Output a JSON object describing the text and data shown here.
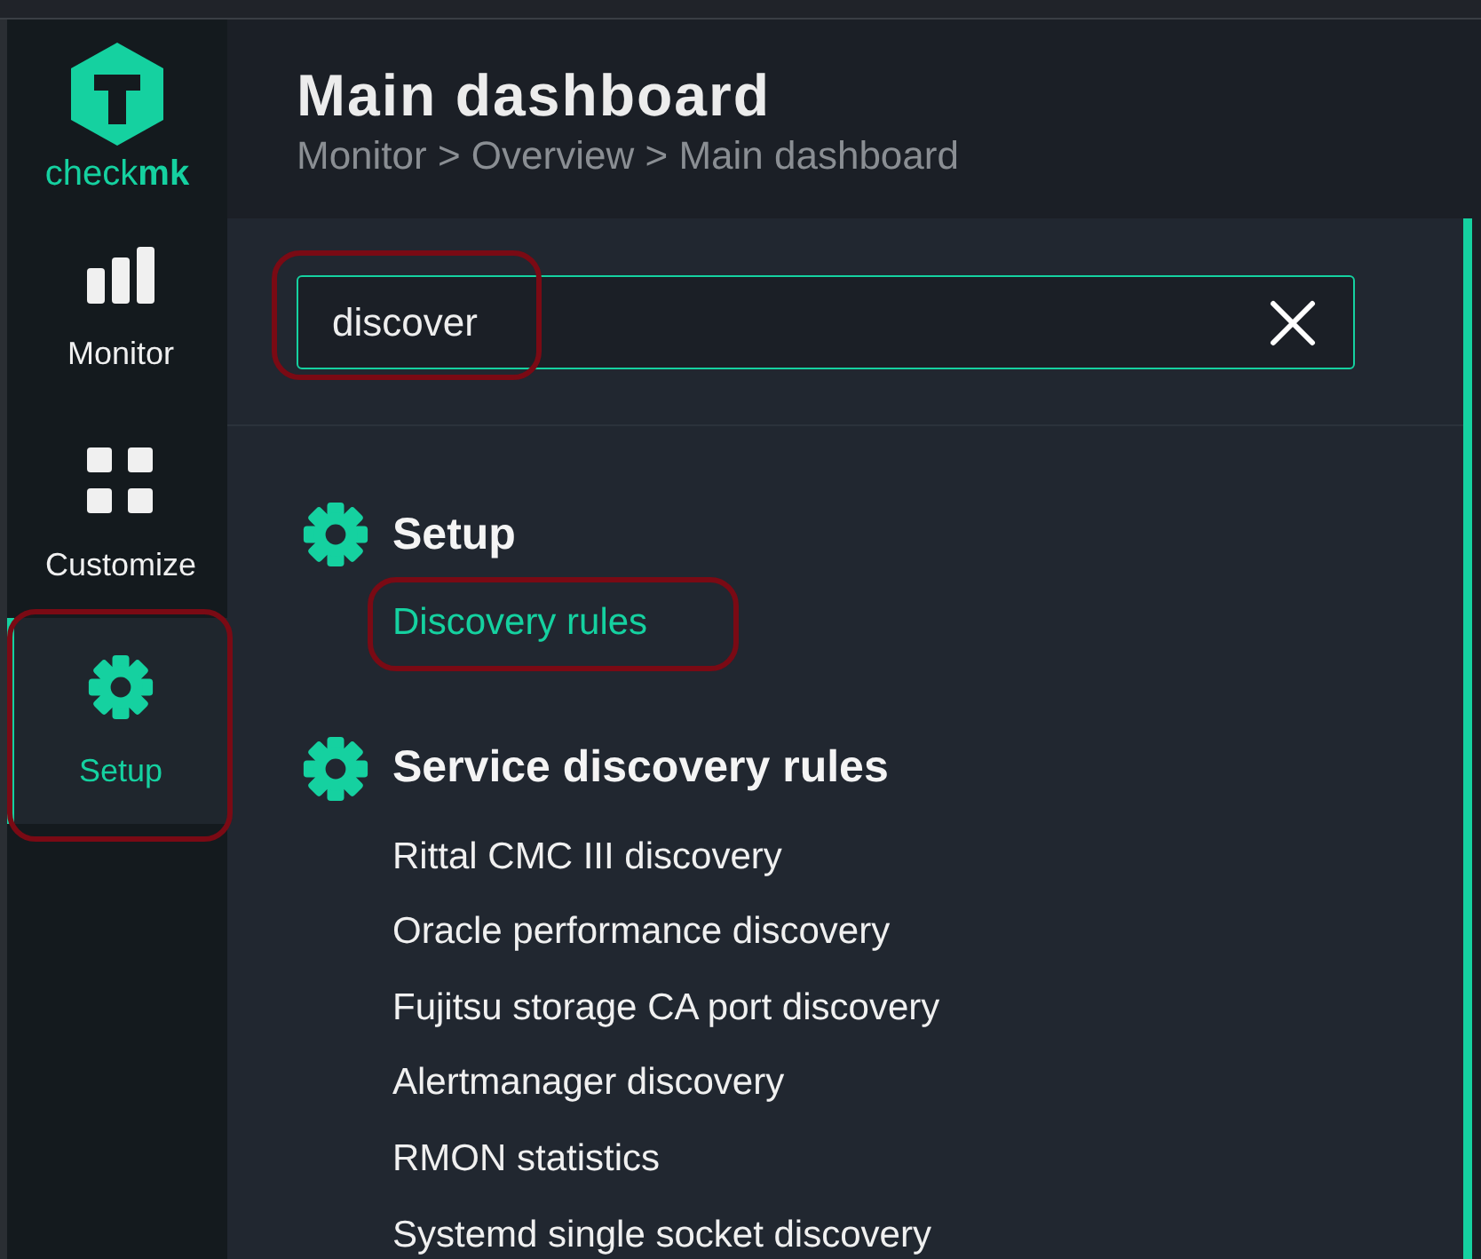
{
  "logo": {
    "text": "check**mk**"
  },
  "nav": [
    {
      "label": "Monitor",
      "kind": "monitor",
      "selected": false
    },
    {
      "label": "Customize",
      "kind": "customize",
      "selected": false
    },
    {
      "label": "Setup",
      "kind": "setup",
      "selected": true
    }
  ],
  "header": {
    "title": "Main dashboard",
    "breadcrumb": "Monitor > Overview > Main dashboard"
  },
  "search": {
    "value": "discover"
  },
  "sections": [
    {
      "title": "Setup",
      "items": [
        {
          "label": "Discovery rules",
          "selected": true
        }
      ]
    },
    {
      "title": "Service discovery rules",
      "items": [
        {
          "label": "Rittal CMC III discovery",
          "selected": false
        },
        {
          "label": "Oracle performance discovery",
          "selected": false
        },
        {
          "label": "Fujitsu storage CA port discovery",
          "selected": false
        },
        {
          "label": "Alertmanager discovery",
          "selected": false
        },
        {
          "label": "RMON statistics",
          "selected": false
        },
        {
          "label": "Systemd single socket discovery",
          "selected": false
        }
      ]
    }
  ]
}
